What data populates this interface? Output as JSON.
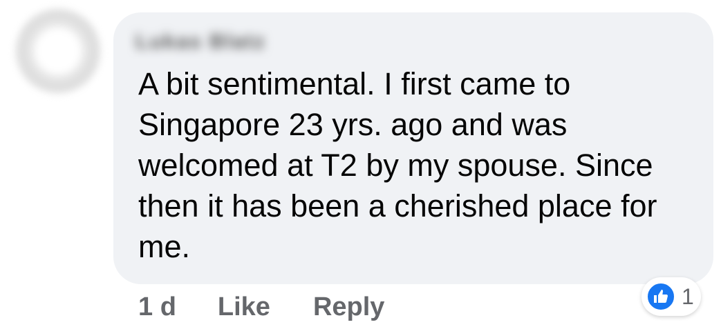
{
  "comment": {
    "author_name": "Lukas Blatz",
    "text": "A bit sentimental. I first came to Singapore 23 yrs. ago and was welcomed at T2 by my spouse. Since then it has been a cherished place for me.",
    "timestamp": "1 d",
    "like_label": "Like",
    "reply_label": "Reply",
    "reaction_count": "1",
    "reaction_icon": "like-icon",
    "accent_color": "#1877f2"
  }
}
